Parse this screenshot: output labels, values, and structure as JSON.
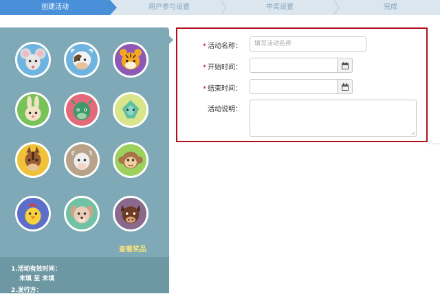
{
  "steps": [
    "创建活动",
    "用户参与设置",
    "中奖设置",
    "完成"
  ],
  "animals": [
    "mouse-icon",
    "ox-icon",
    "tiger-icon",
    "rabbit-icon",
    "dragon-icon",
    "snake-icon",
    "horse-icon",
    "goat-icon",
    "monkey-icon",
    "rooster-icon",
    "dog-icon",
    "pig-icon"
  ],
  "view_prizes": "查看奖品",
  "rules": {
    "line1": "1.活动有效时间：",
    "line2": "未填 至 未填",
    "line3": "2.发行方："
  },
  "form": {
    "name_label": "活动名称：",
    "name_placeholder": "填写活动名称",
    "start_label": "开始时间：",
    "end_label": "结束时间：",
    "desc_label": "活动说明：",
    "required_mark": "*"
  },
  "colors": {
    "accent": "#4a90d9",
    "panel": "#7fa9b6",
    "highlight_border": "#b0101d",
    "required": "#d0021b",
    "prize_link": "#f6e27a"
  }
}
